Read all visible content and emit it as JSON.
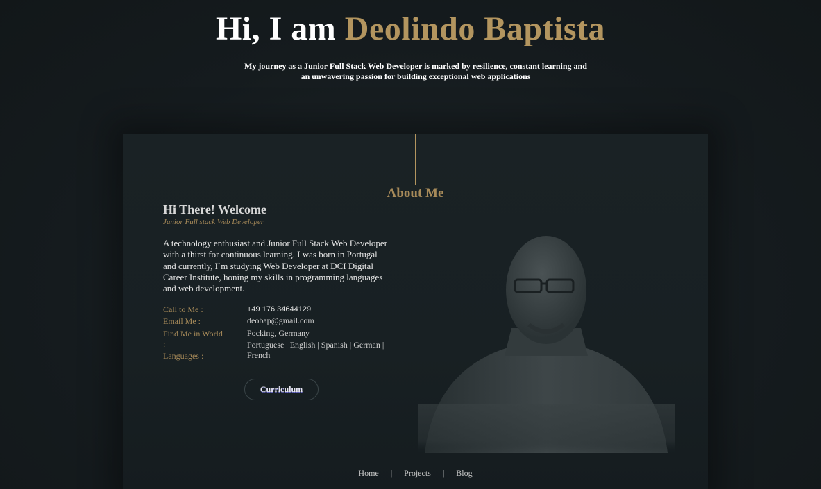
{
  "hero": {
    "greeting": "Hi, I am",
    "name": "Deolindo Baptista",
    "subtitle_line1": "My journey as a Junior Full Stack Web Developer is marked by resilience, constant learning and",
    "subtitle_line2": "an unwavering passion for building exceptional web applications"
  },
  "about": {
    "section_title": "About Me",
    "greeting": "Hi There! Welcome",
    "role": "Junior Full stack Web Developer",
    "bio": "A technology enthusiast and Junior Full Stack Web Developer with a thirst for continuous learning. I was born in Portugal and currently, I`m studying Web Developer at DCI Digital Career Institute, honing my skills in programming languages and web development.",
    "info": {
      "call_label": "Call to Me :",
      "call_value": "+49 176 34644129",
      "email_label": "Email Me :",
      "email_value": "deobap@gmail.com",
      "location_label": "Find Me in World",
      "location_colon": ":",
      "location_value": "Pocking, Germany",
      "languages_label": "Languages :",
      "languages_value_line1": "Portuguese | English | Spanish | German |",
      "languages_value_line2": "French"
    },
    "cv_button": "Curriculum"
  },
  "footer": {
    "home": "Home",
    "projects": "Projects",
    "blog": "Blog",
    "separator": "|"
  },
  "colors": {
    "accent": "#b3955f",
    "background": "#161c1f",
    "card": "#1a2225"
  },
  "icons": [
    "portrait-photo"
  ]
}
